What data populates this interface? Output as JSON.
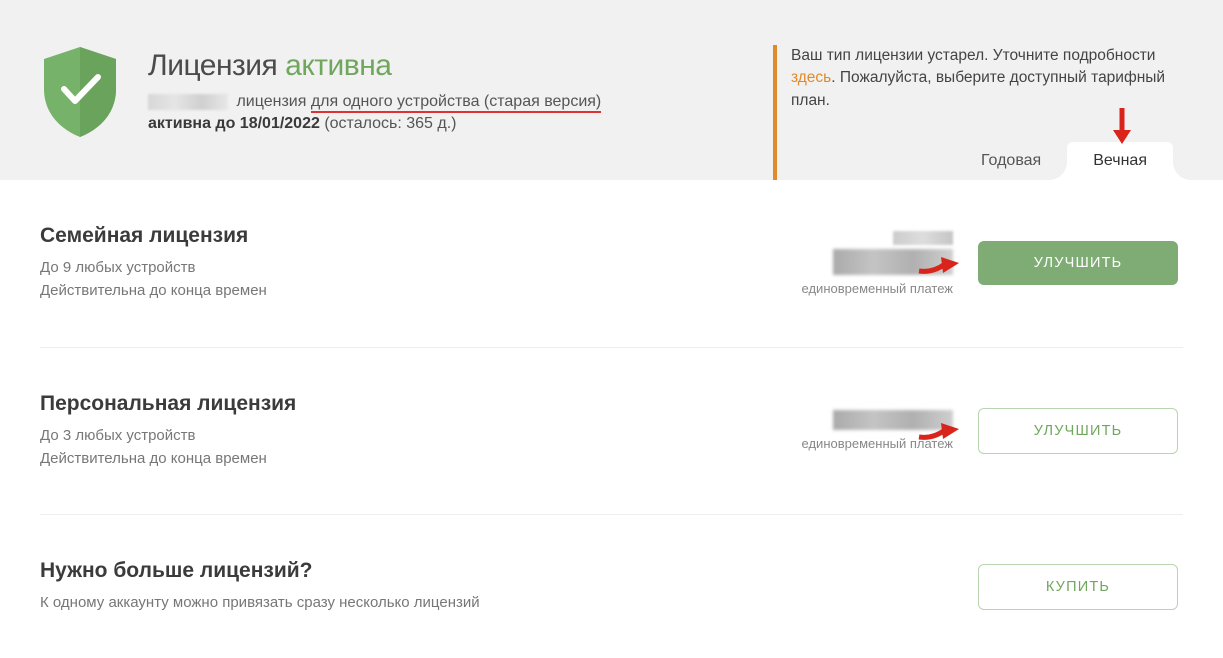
{
  "header": {
    "title_prefix": "Лицензия ",
    "title_status": "активна",
    "line1_suffix": " лицензия ",
    "line1_underlined": "для одного устройства (старая версия)",
    "line2_prefix": "активна до 18/01/2022",
    "line2_suffix": " (осталось: 365 д.)"
  },
  "notice": {
    "part1": "Ваш тип лицензии устарел. Уточните подробности ",
    "link": "здесь",
    "part2": ". Пожалуйста, выберите доступный тарифный план."
  },
  "tabs": {
    "annual": "Годовая",
    "lifetime": "Вечная"
  },
  "plans": {
    "family": {
      "title": "Семейная лицензия",
      "sub1": "До 9 любых устройств",
      "sub2": "Действительна до конца времен",
      "price_note": "единовременный платеж",
      "button": "УЛУЧШИТЬ"
    },
    "personal": {
      "title": "Персональная лицензия",
      "sub1": "До 3 любых устройств",
      "sub2": "Действительна до конца времен",
      "price_note": "единовременный платеж",
      "button": "УЛУЧШИТЬ"
    },
    "more": {
      "title": "Нужно больше лицензий?",
      "sub1": "К одному аккаунту можно привязать сразу несколько лицензий",
      "button": "КУПИТЬ"
    }
  },
  "colors": {
    "accent_green": "#6fa75d",
    "accent_orange": "#e08a2c",
    "arrow_red": "#d9241c"
  }
}
